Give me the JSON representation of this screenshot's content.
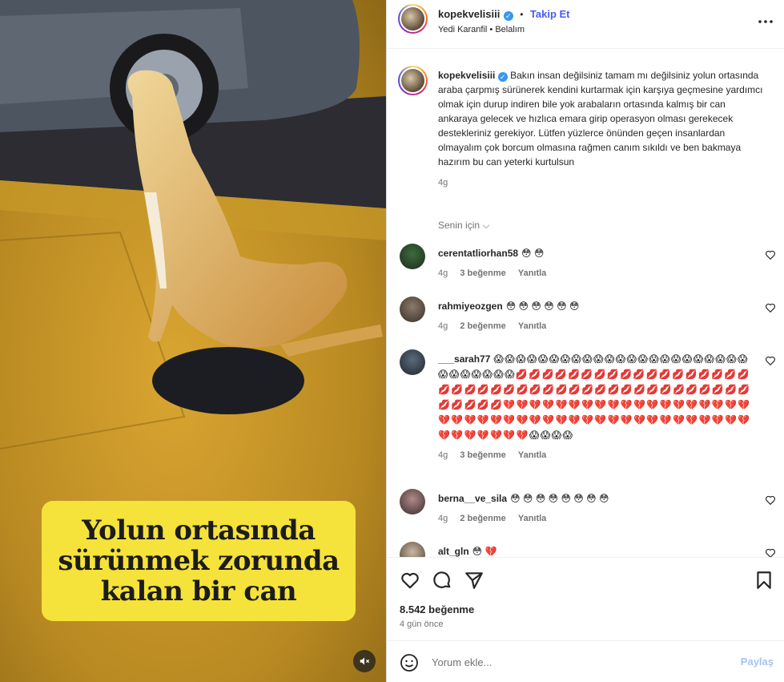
{
  "media": {
    "caption_lines": [
      "Yolun ortasında",
      "sürünmek zorunda",
      "kalan bir can"
    ],
    "mute_icon": "volume-off-icon"
  },
  "header": {
    "username": "kopekvelisiii",
    "dot": "•",
    "follow_label": "Takip Et",
    "music": "Yedi Karanfil",
    "music_sep": "•",
    "music_title": "Belalım",
    "more_label": "•••"
  },
  "post": {
    "username": "kopekvelisiii",
    "text": "Bakın insan değilsiniz tamam mı değilsiniz yolun ortasında araba çarpmış sürünerek kendini kurtarmak için karşıya geçmesine yardımcı olmak için durup indiren bile yok arabaların ortasında kalmış bir can ankaraya gelecek ve hızlıca emara girip operasyon olması gerekecek destekleriniz gerekiyor. Lütfen yüzlerce önünden geçen insanlardan olmayalım çok borcum olmasına rağmen canım sıkıldı ve ben bakmaya hazırım bu can yeterki kurtulsun",
    "age": "4g",
    "for_you": "Senin için"
  },
  "comments": [
    {
      "user": "cerentatliorhan58",
      "text": "😳 😳",
      "age": "4g",
      "likes": "3 beğenme",
      "reply": "Yanıtla"
    },
    {
      "user": "rahmiyeozgen",
      "text": "😳 😳 😳 😳 😳 😳",
      "age": "4g",
      "likes": "2 beğenme",
      "reply": "Yanıtla"
    },
    {
      "user": "___sarah77",
      "text": "😱 😱 😱 😱 😱 😱 😱 😱 😱 😱 😱 😱 😱 😱 😱 😱 😱 😱 😱 😱 😱 😱 😱 😱 😱 😱 😱 😱 😱 😱 💋 💋 💋 💋 💋 💋 💋 💋 💋 💋 💋 💋 💋 💋 💋 💋 💋 💋 💋 💋 💋 💋 💋 💋 💋 💋 💋 💋 💋 💋 💋 💋 💋 💋 💋 💋 💋 💋 💋 💋 💋 💋 💋 💋 💋 💋 💋 💔 💔 💔 💔 💔 💔 💔 💔 💔 💔 💔 💔 💔 💔 💔 💔 💔 💔 💔 💔 💔 💔 💔 💔 💔 💔 💔 💔 💔 💔 💔 💔 💔 💔 💔 💔 💔 💔 💔 💔 💔 💔 💔 💔 💔 💔 💔 💔 💔 💔 😱 😱 😱 😱",
      "age": "4g",
      "likes": "3 beğenme",
      "reply": "Yanıtla"
    },
    {
      "user": "berna__ve_sila",
      "text": "😳 😳 😳 😳 😳 😳 😳 😳",
      "age": "4g",
      "likes": "2 beğenme",
      "reply": "Yanıtla"
    },
    {
      "user": "alt_gln",
      "text": "😳 💔",
      "age": "",
      "likes": "",
      "reply": ""
    }
  ],
  "actions": {
    "like_icon": "heart-outline-icon",
    "comment_icon": "comment-icon",
    "share_icon": "paper-plane-icon",
    "save_icon": "bookmark-icon",
    "likes": "8.542 beğenme",
    "date": "4 gün önce"
  },
  "composer": {
    "placeholder": "Yorum ekle...",
    "share_label": "Paylaş",
    "emoji_icon": "smiley-icon"
  },
  "colors": {
    "link_blue": "#4a5cf0",
    "verified_blue": "#3897f0",
    "caption_yellow": "#f5e23a",
    "muted": "#737373",
    "share_disabled": "#a7c2f5"
  }
}
